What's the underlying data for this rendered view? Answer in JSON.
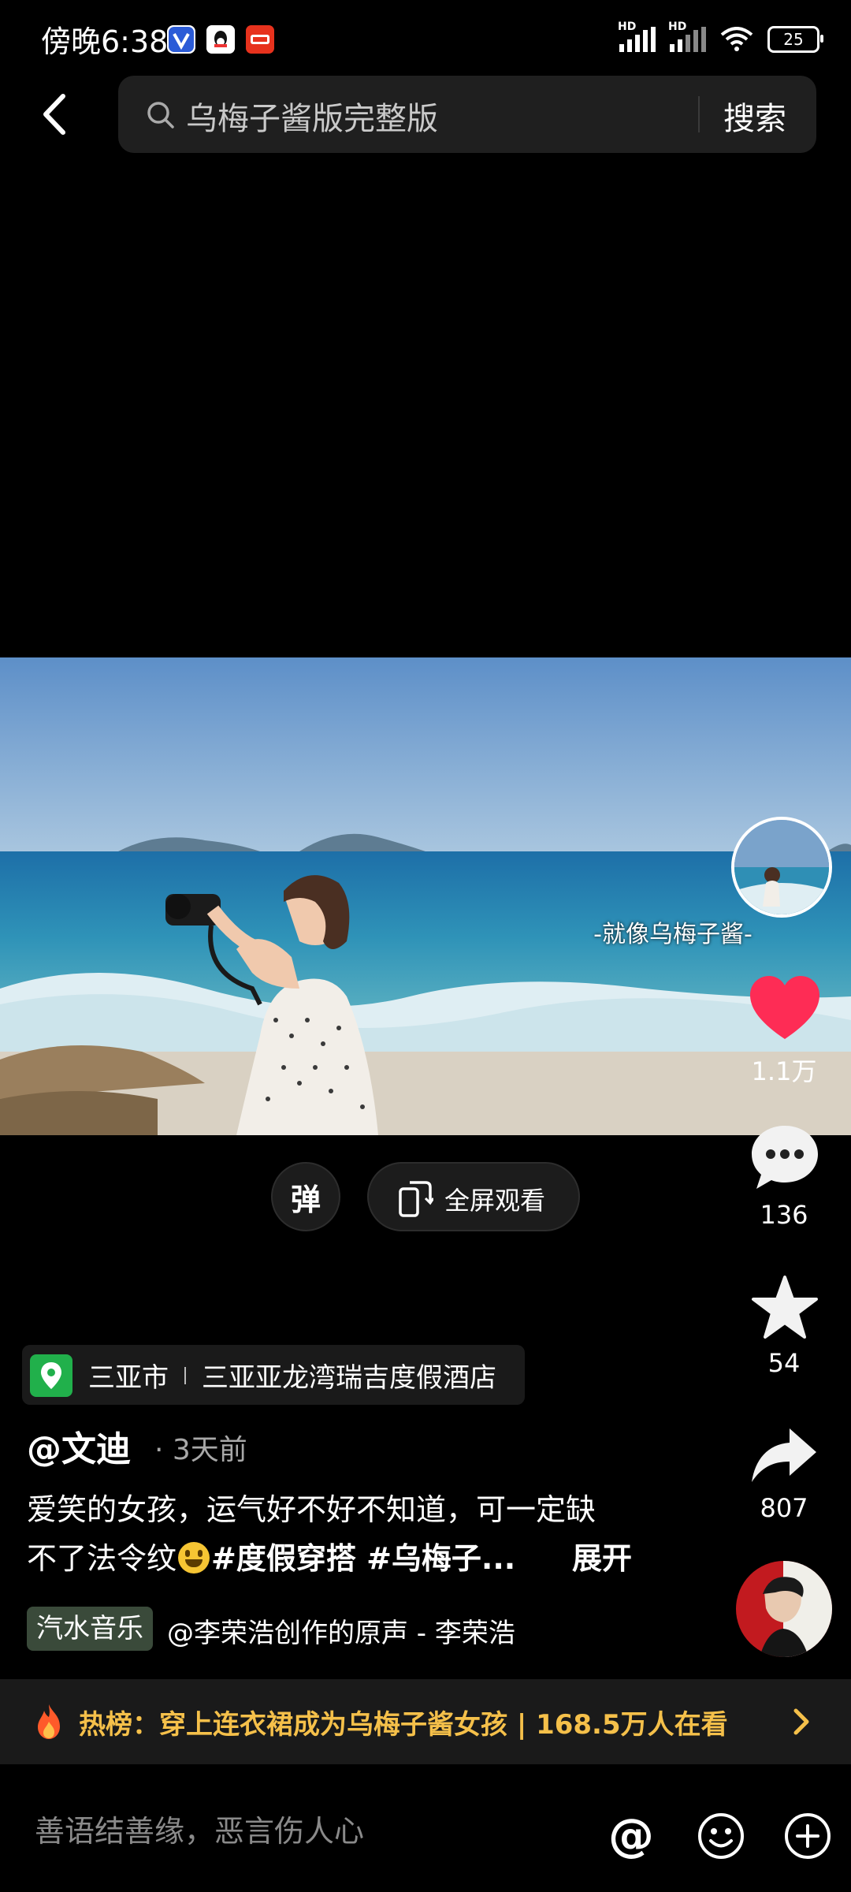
{
  "status": {
    "time": "傍晚6:38",
    "hd1": "HD",
    "hd2": "HD",
    "battery": "25"
  },
  "search": {
    "query": "乌梅子酱版完整版",
    "button_label": "搜索"
  },
  "video": {
    "danmaku_label": "弹",
    "fullscreen_label": "全屏观看"
  },
  "rail": {
    "music_caption": "-就像乌梅子酱-",
    "likes": "1.1万",
    "comments": "136",
    "favorites": "54",
    "shares": "807"
  },
  "post": {
    "location_city": "三亚市",
    "location_place": "三亚亚龙湾瑞吉度假酒店",
    "author": "@文迪",
    "time": "· 3天前",
    "desc_line1": "爱笑的女孩，运气好不好不知道，可一定缺",
    "desc_line2_a": "不了法令纹",
    "desc_line2_b": "#度假穿搭 #乌梅子...",
    "expand_label": "展开",
    "music_tag": "汽水音乐",
    "music_credit": "@李荣浩创作的原声 - 李荣浩"
  },
  "hot": {
    "text": "热榜：穿上连衣裙成为乌梅子酱女孩 | 168.5万人在看"
  },
  "comment_bar": {
    "placeholder": "善语结善缘，恶言伤人心",
    "mention": "@"
  },
  "colors": {
    "like": "#fe2c55",
    "hot_text": "#f5c04a",
    "location_green": "#21b04b"
  }
}
